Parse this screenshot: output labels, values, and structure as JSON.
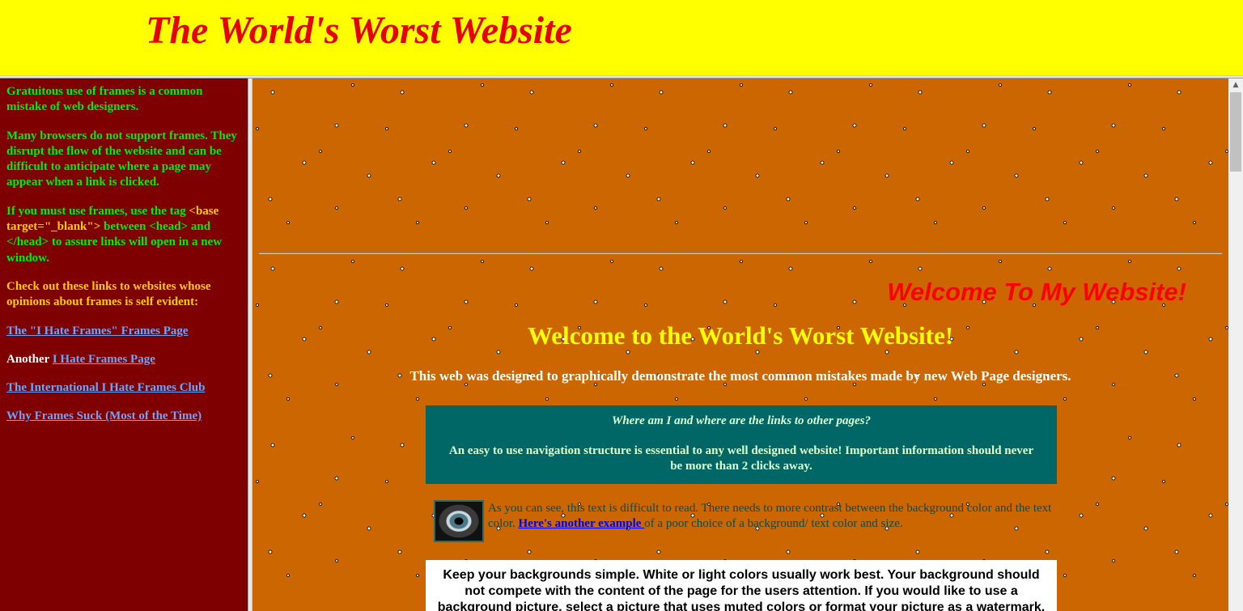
{
  "top": {
    "title": "The World's Worst Website"
  },
  "left": {
    "p1": "Gratuitous use of frames is a common mistake of web designers.",
    "p2": "Many browsers do not support frames. They disrupt the flow of the website and can be difficult to anticipate where a page may appear when a link is clicked.",
    "p3_a": "If you must use frames, use the tag ",
    "p3_tag_open": "<base target=\"_blank\">",
    "p3_b": " between ",
    "p3_tag_head": "<head> and </head>",
    "p3_c": " to assure links will open in a new window.",
    "p4": "Check out these links to websites whose opinions about frames is self evident:",
    "link1": "The \"I Hate Frames\" Frames Page",
    "another_prefix": "Another ",
    "link2": "I Hate Frames Page",
    "link3": "The International I Hate Frames Club",
    "link4": "Why Frames Suck (Most of the Time)"
  },
  "main": {
    "welcome_my": "Welcome To My Website!",
    "welcome_worst": "Welcome to the World's Worst Website!",
    "intro": "This web was designed to graphically demonstrate the most common mistakes made by new Web Page designers.",
    "nav_question": "Where am I and where are the links to other pages?",
    "nav_text": "An easy to use navigation structure is essential to any well designed website! Important information should never be more than 2 clicks away.",
    "contrast_a": "As you can see, this text is difficult to read. There needs to more contrast between the background color and the text color. ",
    "contrast_link": "Here's another example ",
    "contrast_b": "of a poor choice of a background/ text color and size.",
    "bg_text": "Keep your backgrounds simple. White or light colors usually work best. Your background should not compete with the content of the page for the users attention. If you would like to use a background picture, select a picture that uses muted colors or format your picture as a watermark."
  },
  "icons": {
    "scroll_up": "scroll-up-arrow-icon",
    "eye_image": "eye-icon"
  },
  "colors": {
    "top_bg": "#ffff00",
    "title": "#e60000",
    "left_bg": "#7f0000",
    "main_bg": "#cc6600",
    "nav_box_bg": "#006666"
  }
}
